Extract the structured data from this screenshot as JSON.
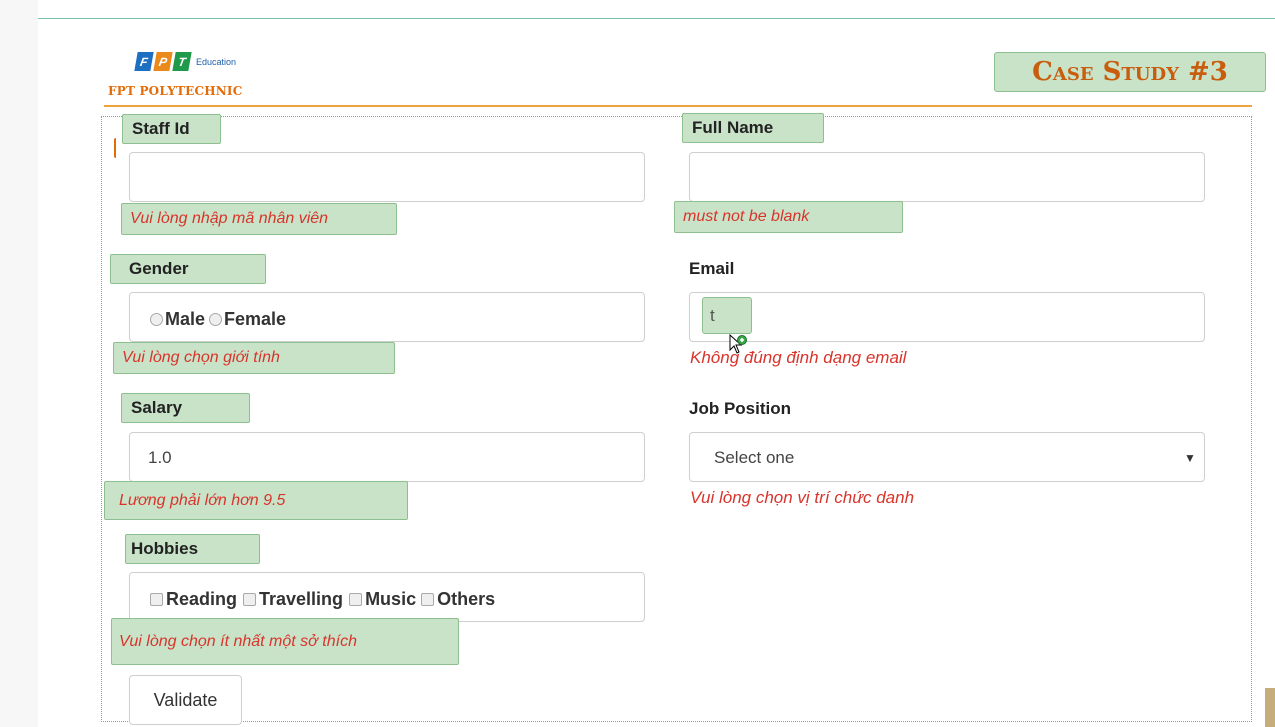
{
  "brand": {
    "logo_letters": [
      "F",
      "P",
      "T"
    ],
    "logo_colors": [
      "#1d6fc2",
      "#e98a1a",
      "#1f9a4a"
    ],
    "logo_sub": "Education",
    "school": "FPT POLYTECHNIC"
  },
  "badge": "Case Study #3",
  "fields": {
    "staff_id": {
      "label": "Staff Id",
      "value": "",
      "error": "Vui lòng nhập mã nhân viên"
    },
    "full_name": {
      "label": "Full Name",
      "value": "",
      "error": "must not be blank"
    },
    "gender": {
      "label": "Gender",
      "options": [
        "Male",
        "Female"
      ],
      "error": "Vui lòng chọn giới tính"
    },
    "email": {
      "label": "Email",
      "value": "t",
      "error": "Không đúng định dạng email"
    },
    "salary": {
      "label": "Salary",
      "value": "1.0",
      "error": "Lương phải lớn hơn 9.5"
    },
    "job_position": {
      "label": "Job Position",
      "selected": "Select one",
      "error": "Vui lòng chọn vị trí chức danh"
    },
    "hobbies": {
      "label": "Hobbies",
      "options": [
        "Reading",
        "Travelling",
        "Music",
        "Others"
      ],
      "error": "Vui lòng chọn ít nhất một sở thích"
    }
  },
  "validate_button": "Validate",
  "colors": {
    "error": "#d9342b",
    "highlight": "#c9e3c9",
    "accent": "#e36c0a"
  }
}
